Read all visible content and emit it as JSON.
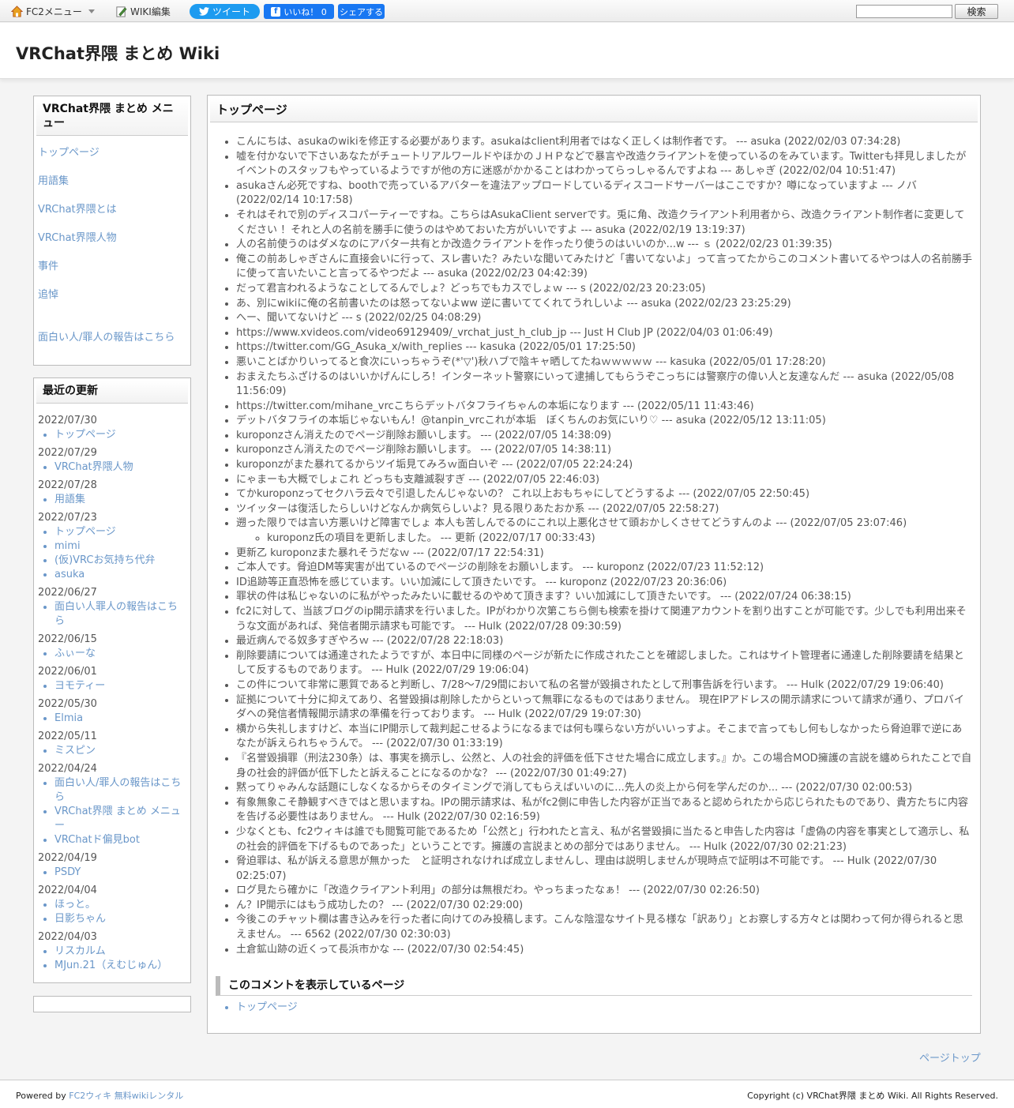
{
  "toolbar": {
    "fc2_menu": "FC2メニュー",
    "wiki_edit": "WIKI編集",
    "tweet": "ツイート",
    "like": "いいね！ 0",
    "share": "シェアする",
    "search_button": "検索",
    "search_value": ""
  },
  "header": {
    "title": "VRChat界隈 まとめ Wiki"
  },
  "sidebar": {
    "menu_title": "VRChat界隈 まとめ メニュー",
    "menu_items": [
      "トップページ",
      "用語集",
      "VRChat界隈とは",
      "VRChat界隈人物",
      "事件",
      "追悼",
      "面白い人/罪人の報告はこちら"
    ],
    "updates_title": "最近の更新",
    "updates": [
      {
        "date": "2022/07/30",
        "items": [
          "トップページ"
        ]
      },
      {
        "date": "2022/07/29",
        "items": [
          "VRChat界隈人物"
        ]
      },
      {
        "date": "2022/07/28",
        "items": [
          "用語集"
        ]
      },
      {
        "date": "2022/07/23",
        "items": [
          "トップページ",
          "mimi",
          "(仮)VRCお気持ち代弁",
          "asuka"
        ]
      },
      {
        "date": "2022/06/27",
        "items": [
          "面白い人罪人の報告はこちら"
        ]
      },
      {
        "date": "2022/06/15",
        "items": [
          "ふぃーな"
        ]
      },
      {
        "date": "2022/06/01",
        "items": [
          "ヨモティー"
        ]
      },
      {
        "date": "2022/05/30",
        "items": [
          "Elmia"
        ]
      },
      {
        "date": "2022/05/11",
        "items": [
          "ミスピン"
        ]
      },
      {
        "date": "2022/04/24",
        "items": [
          "面白い人/罪人の報告はこちら",
          "VRChat界隈 まとめ メニュー",
          "VRChatド偏見bot"
        ]
      },
      {
        "date": "2022/04/19",
        "items": [
          "PSDY"
        ]
      },
      {
        "date": "2022/04/04",
        "items": [
          "ほっと。",
          "日影ちゃん"
        ]
      },
      {
        "date": "2022/04/03",
        "items": [
          "リスカルム",
          "MJun.21（えむじゅん）"
        ]
      }
    ]
  },
  "main": {
    "title": "トップページ",
    "comments": [
      "こんにちは、asukaのwikiを修正する必要があります。asukaはclient利用者ではなく正しくは制作者です。 --- asuka (2022/02/03 07:34:28)",
      "嘘を付かないで下さいあなたがチュートリアルワールドやほかのＪＨＰなどで暴言や改造クライアントを使っているのをみています。Twitterも拝見しましたがイベントのスタッフもやっているようですが他の方に迷惑がかかることはわかってらっしゃるんですよね --- あしゃぎ (2022/02/04 10:51:47)",
      "asukaさん必死ですね、boothで売っているアバターを違法アップロードしているディスコードサーバーはここですか？噂になっていますよ --- ノバ (2022/02/14 10:17:58)",
      "それはそれで別のディスコパーティーですね。こちらはAsukaClient serverです。兎に角、改造クライアント利用者から、改造クライアント制作者に変更してください ！それと人の名前を勝手に使うのはやめておいた方がいいですよ --- asuka (2022/02/19 13:19:37)",
      "人の名前使うのはダメなのにアバター共有とか改造クライアントを作ったり使うのはいいのか...w --- ｓ (2022/02/23 01:39:35)",
      "俺この前あしゃぎさんに直接会いに行って、スレ書いた？みたいな聞いてみたけど「書いてないよ」って言ってたからこのコメント書いてるやつは人の名前勝手に使って言いたいこと言ってるやつだよ --- asuka (2022/02/23 04:42:39)",
      "だって君言われるようなことしてるんでしょ？どっちでもカスでしょｗ --- s (2022/02/23 20:23:05)",
      "あ、別にwikiに俺の名前書いたのは怒ってないよww 逆に書いててくれてうれしいよ --- asuka (2022/02/23 23:25:29)",
      "へー、聞いてないけど --- s (2022/02/25 04:08:29)",
      "https://www.xvideos.com/video69129409/_vrchat_just_h_club_jp --- Just H Club JP (2022/04/03 01:06:49)",
      "https://twitter.com/GG_Asuka_x/with_replies --- kasuka (2022/05/01 17:25:50)",
      "悪いことばかりいってると食次にいっちゃうぞ(*'▽')秋ハブで陰キャ晒してたねｗｗｗｗｗ --- kasuka (2022/05/01 17:28:20)",
      "おまえたちふざけるのはいいかげんにしろ！インターネット警察にいって逮捕してもらうぞこっちには警察庁の偉い人と友達なんだ --- asuka (2022/05/08 11:56:09)",
      "https://twitter.com/mihane_vrcこちらデットバタフライちゃんの本垢になります --- (2022/05/11 11:43:46)",
      "デットバタフライの本垢じゃないもん！@tanpin_vrcこれが本垢　ぼくちんのお気にいり♡ --- asuka (2022/05/12 13:11:05)",
      "kuroponzさん消えたのでページ削除お願いします。 --- (2022/07/05 14:38:09)",
      "kuroponzさん消えたのでページ削除お願いします。 --- (2022/07/05 14:38:11)",
      "kuroponzがまた暴れてるからツイ垢見てみろｗ面白いぞ --- (2022/07/05 22:24:24)",
      "にゃまーも大概でしょこれ どっちも支離滅裂すぎ --- (2022/07/05 22:46:03)",
      "てかkuroponzってセクハラ云々で引退したんじゃないの？ これ以上おもちゃにしてどうするよ --- (2022/07/05 22:50:45)",
      "ツイッターは復活したらしいけどなんか病気らしいよ？見る限りあたおか系 --- (2022/07/05 22:58:27)",
      "遡った限りでは言い方悪いけど障害でしょ 本人も苦しんでるのにこれ以上悪化させて頭おかしくさせてどうすんのよ --- (2022/07/05 23:07:46)",
      "更新乙 kuroponzまた暴れそうだなｗ --- (2022/07/17 22:54:31)",
      "ご本人です。脅迫DM等実害が出ているのでページの削除をお願いします。 --- kuroponz (2022/07/23 11:52:12)",
      "ID追跡等正直恐怖を感じています。いい加減にして頂きたいです。 --- kuroponz (2022/07/23 20:36:06)",
      "罪状の件は私じゃないのに私がやったみたいに載せるのやめて頂きます？いい加減にして頂きたいです。 --- (2022/07/24 06:38:15)",
      "fc2に対して、当該ブログのip開示請求を行いました。IPがわかり次第こちら側も検索を掛けて関連アカウントを割り出すことが可能です。少しでも利用出来そうな文面があれば、発信者開示請求も可能です。 --- Hulk (2022/07/28 09:30:59)",
      "最近病んでる奴多すぎやろｗ --- (2022/07/28 22:18:03)",
      "削除要請については通達されたようですが、本日中に同様のページが新たに作成されたことを確認しました。これはサイト管理者に通達した削除要請を結果として反するものであります。 --- Hulk (2022/07/29 19:06:04)",
      "この件について非常に悪質であると判断し、7/28～7/29間において私の名誉が毀損されたとして刑事告訴を行います。 --- Hulk (2022/07/29 19:06:40)",
      "証拠について十分に抑えてあり、名誉毀損は削除したからといって無罪になるものではありません。 現在IPアドレスの開示請求について請求が通り、プロバイダへの発信者情報開示請求の準備を行っております。 --- Hulk (2022/07/29 19:07:30)",
      "横から失礼しますけど、本当にIP開示して裁判起こせるようになるまでは何も喋らない方がいいっすよ。そこまで言ってもし何もしなかったら脅迫罪で逆にあなたが訴えられちゃうんで。 --- (2022/07/30 01:33:19)",
      "『名誉毀損罪（刑法230条）は、事実を摘示し、公然と、人の社会的評価を低下させた場合に成立します。』か。この場合MOD擁護の言説を纏められたことで自身の社会的評価が低下したと訴えることになるのかな？ --- (2022/07/30 01:49:27)",
      "黙ってりゃみんな話題にしなくなるからそのタイミングで消してもらえばいいのに...先人の炎上から何を学んだのか... --- (2022/07/30 02:00:53)",
      "有象無象こそ静観すべきではと思いますね。IPの開示請求は、私がfc2側に申告した内容が正当であると認められたから応じられたものであり、貴方たちに内容を告げる必要性はありません。 --- Hulk (2022/07/30 02:16:59)",
      "少なくとも、fc2ウィキは誰でも閲覧可能であるため「公然と」行われたと言え、私が名誉毀損に当たると申告した内容は「虚偽の内容を事実として適示し、私の社会的評価を下げるものであった」ということです。擁護の言説まとめの部分ではありません。 --- Hulk (2022/07/30 02:21:23)",
      "脅迫罪は、私が訴える意思が無かった　と証明されなければ成立しませんし、理由は説明しませんが現時点で証明は不可能です。 --- Hulk (2022/07/30 02:25:07)",
      "ログ見たら確かに「改造クライアント利用」の部分は無根だわ。やっちまったなぁ！ --- (2022/07/30 02:26:50)",
      "ん？IP開示にはもう成功したの？ --- (2022/07/30 02:29:00)",
      "今後このチャット欄は書き込みを行った者に向けてのみ投稿します。こんな陰湿なサイト見る様な「訳あり」とお察しする方々とは関わって何か得られると思えません。 --- 6562 (2022/07/30 02:30:03)",
      "土倉鉱山跡の近くって長浜市かな --- (2022/07/30 02:54:45)"
    ],
    "sub_comment": "kuroponz氏の項目を更新しました。 --- 更新 (2022/07/17 00:33:43)",
    "pages_title": "このコメントを表示しているページ",
    "pages": [
      "トップページ"
    ]
  },
  "page_top": "ページトップ",
  "footer": {
    "powered_by": "Powered by",
    "fc2_link": "FC2ウィキ",
    "rental_link": "無料wikiレンタル",
    "copyright": "Copyright (c) VRChat界隈 まとめ Wiki. All Rights Reserved."
  }
}
